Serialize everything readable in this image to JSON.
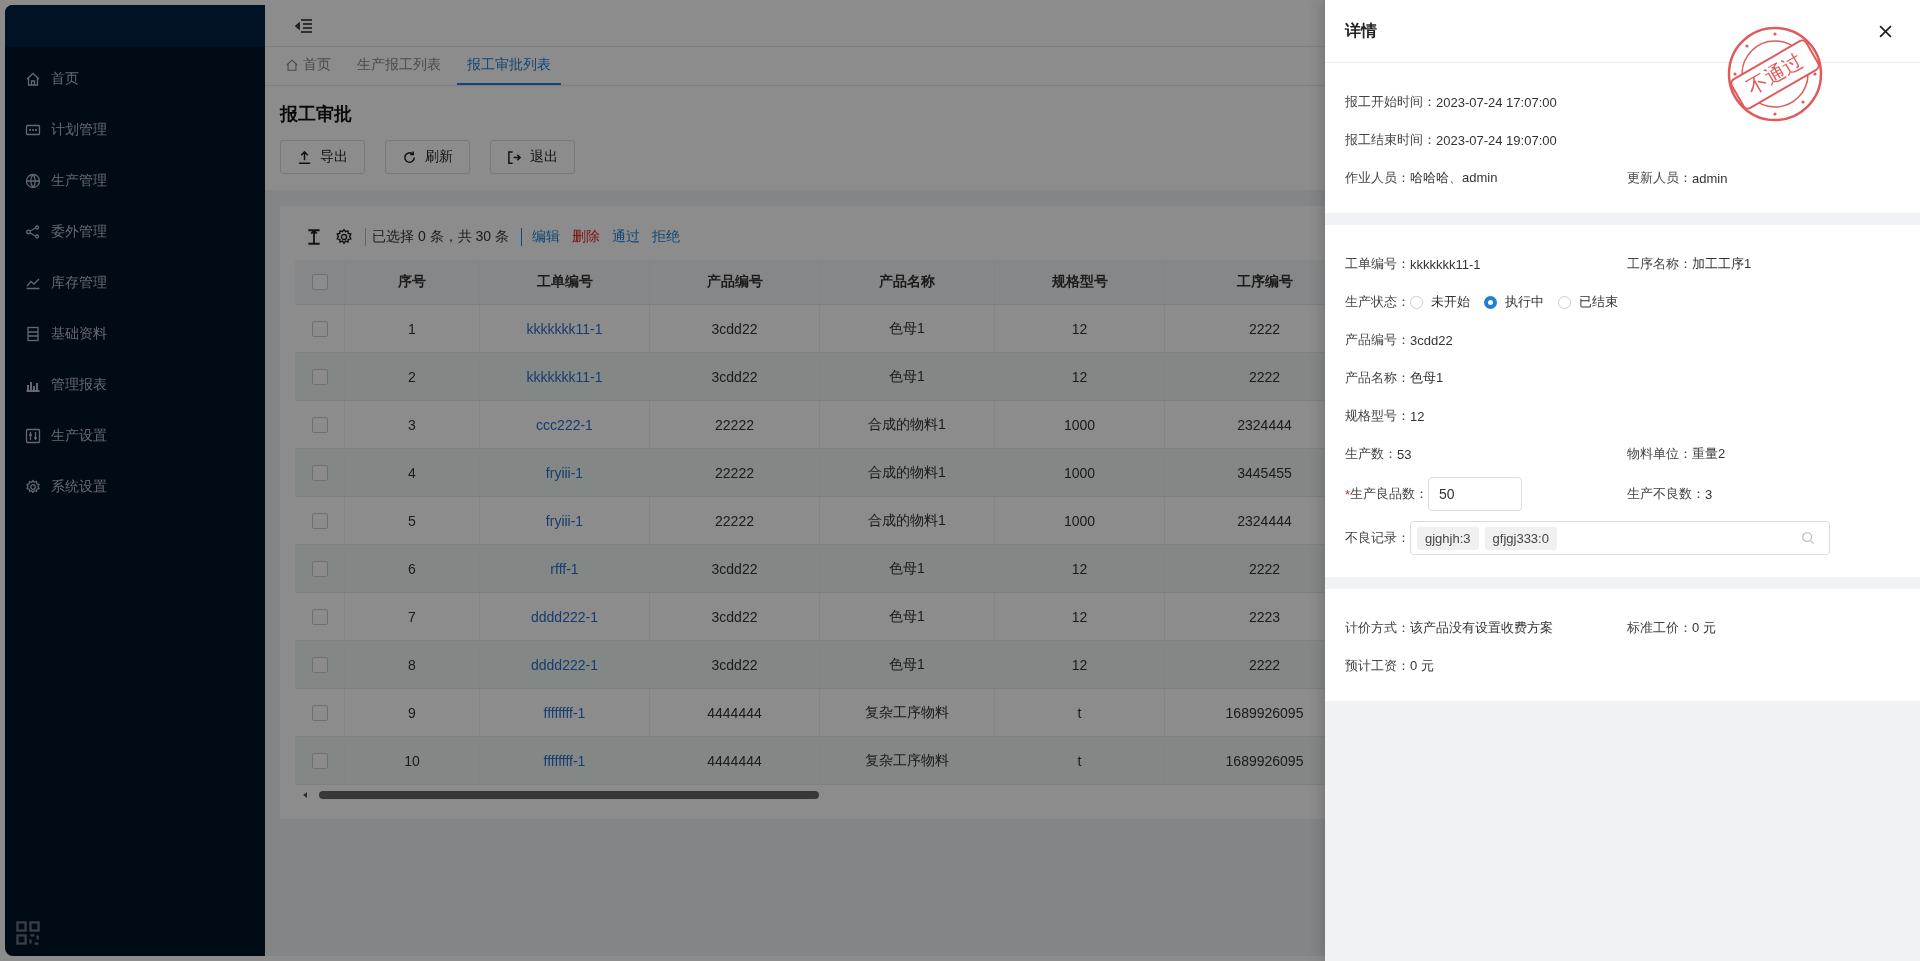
{
  "sidebar": {
    "items": [
      {
        "label": "首页"
      },
      {
        "label": "计划管理"
      },
      {
        "label": "生产管理"
      },
      {
        "label": "委外管理"
      },
      {
        "label": "库存管理"
      },
      {
        "label": "基础资料"
      },
      {
        "label": "管理报表"
      },
      {
        "label": "生产设置"
      },
      {
        "label": "系统设置"
      }
    ]
  },
  "tabs": [
    {
      "label": "首页",
      "selected": false
    },
    {
      "label": "生产报工列表",
      "selected": false
    },
    {
      "label": "报工审批列表",
      "selected": true
    }
  ],
  "page_title": "报工审批",
  "toolbar_buttons": [
    "导出",
    "刷新",
    "退出"
  ],
  "table": {
    "selection_info": "已选择 0 条，共 30 条",
    "actions": [
      {
        "label": "编辑",
        "kind": "link"
      },
      {
        "label": "删除",
        "kind": "danger"
      },
      {
        "label": "通过",
        "kind": "link"
      },
      {
        "label": "拒绝",
        "kind": "link"
      }
    ],
    "all_checked": false,
    "columns": [
      {
        "label": "序号",
        "kind": "text"
      },
      {
        "label": "工单编号",
        "kind": "link"
      },
      {
        "label": "产品编号",
        "kind": "text"
      },
      {
        "label": "产品名称",
        "kind": "text"
      },
      {
        "label": "规格型号",
        "kind": "text"
      },
      {
        "label": "工序编号",
        "kind": "text"
      }
    ],
    "rows": [
      {
        "checked": false,
        "cells": [
          "1",
          "kkkkkkk11-1",
          "3cdd22",
          "色母1",
          "12",
          "2222"
        ]
      },
      {
        "checked": false,
        "cells": [
          "2",
          "kkkkkkk11-1",
          "3cdd22",
          "色母1",
          "12",
          "2222"
        ]
      },
      {
        "checked": false,
        "cells": [
          "3",
          "ccc222-1",
          "22222",
          "合成的物料1",
          "1000",
          "2324444"
        ]
      },
      {
        "checked": false,
        "cells": [
          "4",
          "fryiii-1",
          "22222",
          "合成的物料1",
          "1000",
          "3445455"
        ]
      },
      {
        "checked": false,
        "cells": [
          "5",
          "fryiii-1",
          "22222",
          "合成的物料1",
          "1000",
          "2324444"
        ]
      },
      {
        "checked": false,
        "cells": [
          "6",
          "rfff-1",
          "3cdd22",
          "色母1",
          "12",
          "2222"
        ]
      },
      {
        "checked": false,
        "cells": [
          "7",
          "dddd222-1",
          "3cdd22",
          "色母1",
          "12",
          "2223"
        ]
      },
      {
        "checked": false,
        "cells": [
          "8",
          "dddd222-1",
          "3cdd22",
          "色母1",
          "12",
          "2222"
        ]
      },
      {
        "checked": false,
        "cells": [
          "9",
          "ffffffff-1",
          "4444444",
          "复杂工序物料",
          "t",
          "1689926095"
        ]
      },
      {
        "checked": false,
        "cells": [
          "10",
          "ffffffff-1",
          "4444444",
          "复杂工序物料",
          "t",
          "1689926095"
        ]
      }
    ]
  },
  "drawer": {
    "title": "详情",
    "stamp": "不通过",
    "sections": [
      {
        "rows": [
          [
            {
              "kind": "text",
              "label": "报工开始时间：",
              "value": "2023-07-24 17:07:00"
            }
          ],
          [
            {
              "kind": "text",
              "label": "报工结束时间：",
              "value": "2023-07-24 19:07:00"
            }
          ],
          [
            {
              "kind": "text",
              "label": "作业人员：",
              "value": "哈哈哈、admin"
            },
            {
              "kind": "text",
              "label": "更新人员：",
              "value": "admin"
            }
          ]
        ]
      },
      {
        "rows": [
          [
            {
              "kind": "text",
              "label": "工单编号：",
              "value": "kkkkkkk11-1"
            },
            {
              "kind": "text",
              "label": "工序名称：",
              "value": "加工工序1"
            }
          ],
          [
            {
              "kind": "radio",
              "label": "生产状态：",
              "options": [
                {
                  "label": "未开始",
                  "selected": false
                },
                {
                  "label": "执行中",
                  "selected": true
                },
                {
                  "label": "已结束",
                  "selected": false
                }
              ]
            }
          ],
          [
            {
              "kind": "text",
              "label": "产品编号：",
              "value": "3cdd22"
            }
          ],
          [
            {
              "kind": "text",
              "label": "产品名称：",
              "value": "色母1"
            }
          ],
          [
            {
              "kind": "text",
              "label": "规格型号：",
              "value": "12"
            }
          ],
          [
            {
              "kind": "text",
              "label": "生产数：",
              "value": "53"
            },
            {
              "kind": "text",
              "label": "物料单位：",
              "value": "重量2"
            }
          ],
          [
            {
              "kind": "input",
              "required_mark": "*",
              "label": "生产良品数：",
              "value": "50"
            },
            {
              "kind": "text",
              "label": "生产不良数：",
              "value": "3"
            }
          ],
          [
            {
              "kind": "tags",
              "label": "不良记录：",
              "tags": [
                "gjghjh:3",
                "gfjgj333:0"
              ]
            }
          ]
        ]
      },
      {
        "rows": [
          [
            {
              "kind": "text",
              "label": "计价方式：",
              "value": "该产品没有设置收费方案"
            },
            {
              "kind": "text",
              "label": "标准工价：",
              "value": "0 元"
            }
          ],
          [
            {
              "kind": "text",
              "label": "预计工资：",
              "value": "0 元"
            }
          ]
        ]
      }
    ]
  }
}
